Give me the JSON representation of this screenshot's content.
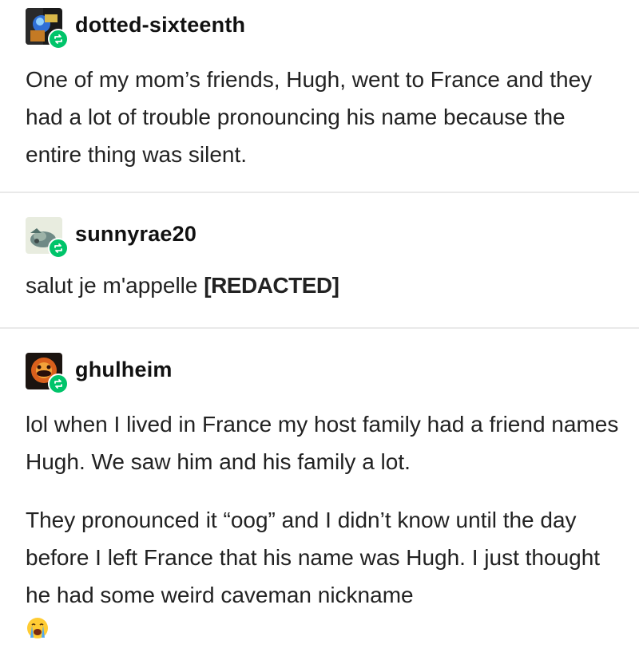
{
  "posts": [
    {
      "username": "dotted-sixteenth",
      "avatar_icon": "blue-figure-avatar",
      "paragraphs": [
        "One of my mom’s friends, Hugh, went to France and they had a lot of trouble pronouncing his name because the entire thing was silent."
      ]
    },
    {
      "username": "sunnyrae20",
      "avatar_icon": "stone-creature-avatar",
      "text_before": "salut je m'appelle ",
      "redacted": "[REDACTED]"
    },
    {
      "username": "ghulheim",
      "avatar_icon": "orange-mask-avatar",
      "paragraphs": [
        "lol when I lived in France my host family had a friend names Hugh. We saw him and his family a lot.",
        "They pronounced it “oog” and I didn’t know until the day before I left France that his name was Hugh. I just thought he had some weird caveman nickname"
      ],
      "emoji": "loudly-crying-face-emoji"
    }
  ],
  "colors": {
    "reblog_badge": "#00c46a",
    "divider": "#e9e9e9",
    "text": "#222222"
  }
}
